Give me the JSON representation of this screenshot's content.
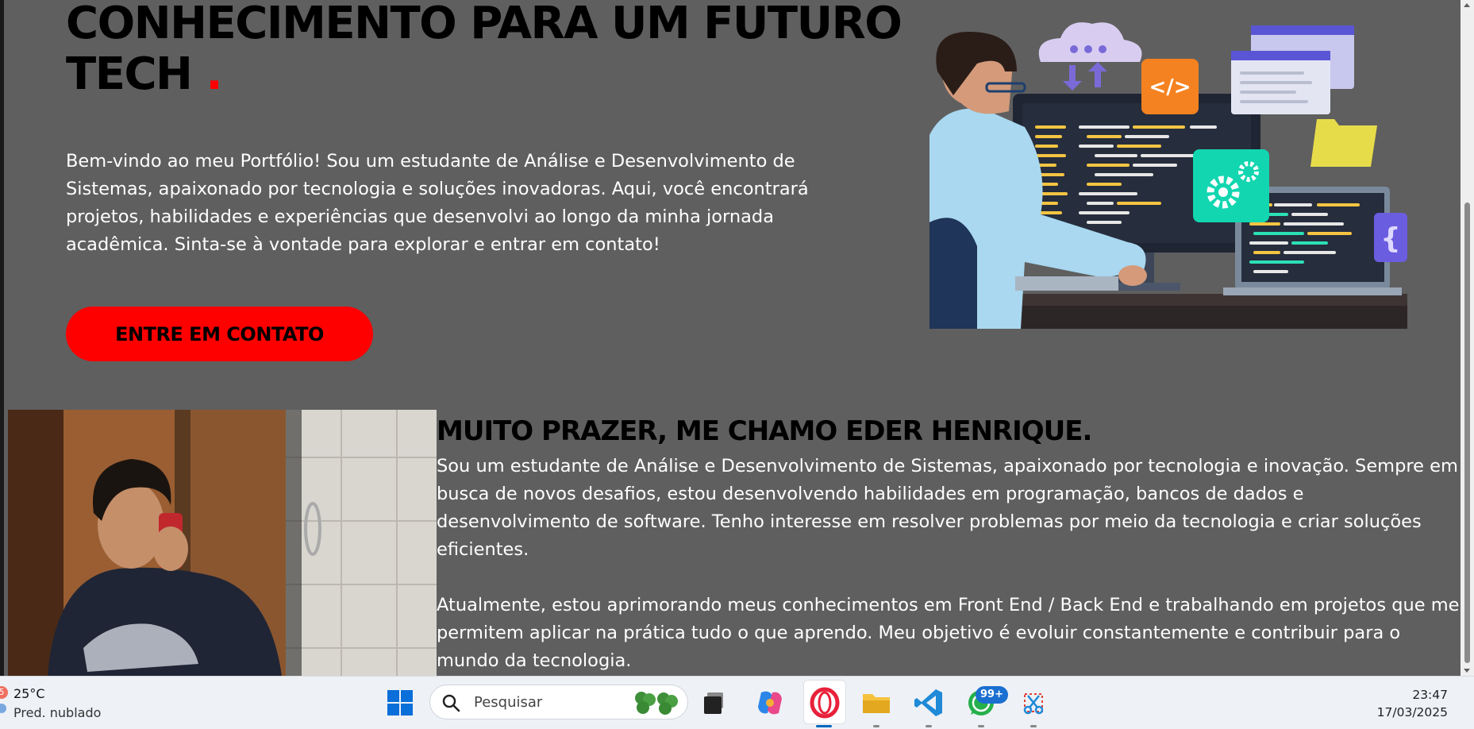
{
  "hero": {
    "title_line1": "CONHECIMENTO PARA UM FUTURO",
    "title_line2": "TECH",
    "title_dot": ".",
    "intro": "Bem-vindo ao meu Portfólio! Sou um estudante de Análise e Desenvolvimento de Sistemas, apaixonado por tecnologia e soluções inovadoras. Aqui, você encontrará projetos, habilidades e experiências que desenvolvi ao longo da minha jornada acadêmica. Sinta-se à vontade para explorar e entrar em contato!",
    "cta_label": "ENTRE EM CONTATO",
    "illustration_code_tag": "</>"
  },
  "about": {
    "title": "MUITO PRAZER, ME CHAMO EDER HENRIQUE.",
    "paragraph1": "Sou um estudante de Análise e Desenvolvimento de Sistemas, apaixonado por tecnologia e inovação. Sempre em busca de novos desafios, estou desenvolvendo habilidades em programação, bancos de dados e desenvolvimento de software. Tenho interesse em resolver problemas por meio da tecnologia e criar soluções eficientes.",
    "paragraph2": "Atualmente, estou aprimorando meus conhecimentos em Front End / Back End e trabalhando em projetos que me permitem aplicar na prática tudo o que aprendo. Meu objetivo é evoluir constantemente e contribuir para o mundo da tecnologia."
  },
  "colors": {
    "page_bg": "#5f5f5f",
    "accent": "#ff0000",
    "taskbar_bg": "#eef1f6"
  },
  "taskbar": {
    "weather_temp": "25°C",
    "weather_condition": "Pred. nublado",
    "search_placeholder": "Pesquisar",
    "whatsapp_badge": "99+",
    "time": "23:47",
    "date": "17/03/2025",
    "apps": [
      "windows-start-icon",
      "task-view-icon",
      "copilot-icon",
      "opera-icon",
      "file-explorer-icon",
      "vscode-icon",
      "whatsapp-icon",
      "snipping-tool-icon"
    ]
  }
}
